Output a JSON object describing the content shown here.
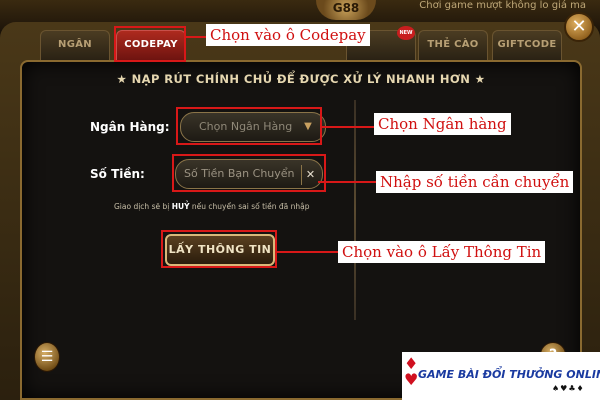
{
  "top_bar": {
    "text": "Chơi game mượt không lo giá ma",
    "logo": "G88"
  },
  "tabs": [
    {
      "label": "NGÂN HÀNG"
    },
    {
      "label": "CODEPAY"
    },
    {
      "label": ""
    },
    {
      "label": "THẺ CÀO"
    },
    {
      "label": "GIFTCODE"
    }
  ],
  "new_badge": "NEW",
  "close_icon": "close-icon",
  "form": {
    "headline": "★ NẠP RÚT CHÍNH CHỦ ĐỂ ĐƯỢC XỬ LÝ NHANH HƠN ★",
    "bank_label": "Ngân Hàng:",
    "bank_select": "Chọn Ngân Hàng",
    "amount_label": "Số Tiền:",
    "amount_placeholder": "Số Tiền Bạn Chuyển",
    "clear_label": "✕",
    "notice_prefix": "Giao dịch sẽ bị ",
    "notice_bold": "HUỶ",
    "notice_suffix": " nếu chuyển sai số tiền đã nhập",
    "fetch_button": "LẤY THÔNG TIN"
  },
  "annotations": {
    "codepay": "Chọn vào ô Codepay",
    "bank": "Chọn Ngân hàng",
    "amount": "Nhập số tiền cần chuyển",
    "fetch": "Chọn vào ô Lấy Thông Tin"
  },
  "watermark": {
    "text": "GAME BÀI ĐỔI THƯỞNG ONLINE",
    "suits": "♠♥♣♦"
  },
  "colors": {
    "accent_red": "#d81818",
    "active_tab": "#ae2a1e",
    "gold": "#d9b87a"
  }
}
